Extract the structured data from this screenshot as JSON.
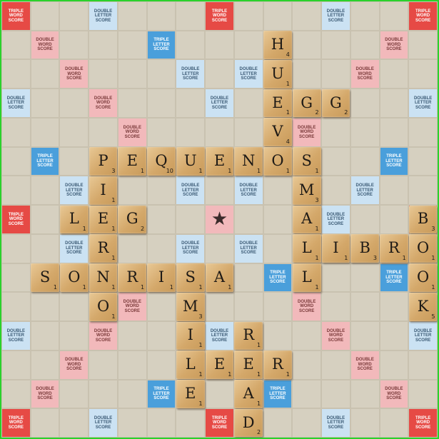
{
  "board": {
    "size": 15,
    "colors": {
      "TW": "#e64a45",
      "DW": "#f2b9bb",
      "TL": "#4a9fdb",
      "DL": "#cbe2f3",
      "plain": "#d6d0c0"
    },
    "labels": {
      "TW": "TRIPLE WORD SCORE",
      "DW": "DOUBLE WORD SCORE",
      "TL": "TRIPLE LETTER SCORE",
      "DL": "DOUBLE LETTER SCORE"
    },
    "premium_rows": [
      "T..d...T...d..T",
      ".D...t...t...D.",
      "..D...d.d...D..",
      "d..D...d...D..d",
      "....D.....D....",
      ".t...t...t...t.",
      "..d...d.d...d..",
      "T..d...S...d..T",
      "..d...d.d...d..",
      ".t...t...t...t.",
      "....D.....D....",
      "d..D...d...D..d",
      "..D...d.d...D..",
      ".D...t...t...D.",
      "T..d...T...d..T"
    ],
    "center_icon": "star-icon"
  },
  "tiles": [
    {
      "letter": "H",
      "points": "4",
      "row": 1,
      "col": 9
    },
    {
      "letter": "U",
      "points": "1",
      "row": 2,
      "col": 9
    },
    {
      "letter": "E",
      "points": "1",
      "row": 3,
      "col": 9
    },
    {
      "letter": "G",
      "points": "2",
      "row": 3,
      "col": 10
    },
    {
      "letter": "G",
      "points": "2",
      "row": 3,
      "col": 11
    },
    {
      "letter": "V",
      "points": "4",
      "row": 4,
      "col": 9
    },
    {
      "letter": "P",
      "points": "3",
      "row": 5,
      "col": 3
    },
    {
      "letter": "E",
      "points": "1",
      "row": 5,
      "col": 4
    },
    {
      "letter": "Q",
      "points": "10",
      "row": 5,
      "col": 5
    },
    {
      "letter": "U",
      "points": "1",
      "row": 5,
      "col": 6
    },
    {
      "letter": "E",
      "points": "1",
      "row": 5,
      "col": 7
    },
    {
      "letter": "N",
      "points": "1",
      "row": 5,
      "col": 8
    },
    {
      "letter": "O",
      "points": "1",
      "row": 5,
      "col": 9
    },
    {
      "letter": "S",
      "points": "1",
      "row": 5,
      "col": 10
    },
    {
      "letter": "I",
      "points": "1",
      "row": 6,
      "col": 3
    },
    {
      "letter": "M",
      "points": "3",
      "row": 6,
      "col": 10
    },
    {
      "letter": "L",
      "points": "1",
      "row": 7,
      "col": 2
    },
    {
      "letter": "E",
      "points": "1",
      "row": 7,
      "col": 3
    },
    {
      "letter": "G",
      "points": "2",
      "row": 7,
      "col": 4
    },
    {
      "letter": "A",
      "points": "1",
      "row": 7,
      "col": 10
    },
    {
      "letter": "B",
      "points": "3",
      "row": 7,
      "col": 14
    },
    {
      "letter": "R",
      "points": "1",
      "row": 8,
      "col": 3
    },
    {
      "letter": "L",
      "points": "1",
      "row": 8,
      "col": 10
    },
    {
      "letter": "I",
      "points": "1",
      "row": 8,
      "col": 11
    },
    {
      "letter": "B",
      "points": "3",
      "row": 8,
      "col": 12
    },
    {
      "letter": "R",
      "points": "1",
      "row": 8,
      "col": 13
    },
    {
      "letter": "O",
      "points": "1",
      "row": 8,
      "col": 14
    },
    {
      "letter": "S",
      "points": "1",
      "row": 9,
      "col": 1
    },
    {
      "letter": "O",
      "points": "1",
      "row": 9,
      "col": 2
    },
    {
      "letter": "N",
      "points": "1",
      "row": 9,
      "col": 3
    },
    {
      "letter": "R",
      "points": "1",
      "row": 9,
      "col": 4
    },
    {
      "letter": "I",
      "points": "1",
      "row": 9,
      "col": 5
    },
    {
      "letter": "S",
      "points": "1",
      "row": 9,
      "col": 6
    },
    {
      "letter": "A",
      "points": "1",
      "row": 9,
      "col": 7
    },
    {
      "letter": "L",
      "points": "1",
      "row": 9,
      "col": 10
    },
    {
      "letter": "O",
      "points": "1",
      "row": 9,
      "col": 14
    },
    {
      "letter": "O",
      "points": "1",
      "row": 10,
      "col": 3
    },
    {
      "letter": "M",
      "points": "3",
      "row": 10,
      "col": 6
    },
    {
      "letter": "K",
      "points": "5",
      "row": 10,
      "col": 14
    },
    {
      "letter": "I",
      "points": "1",
      "row": 11,
      "col": 6
    },
    {
      "letter": "R",
      "points": "1",
      "row": 11,
      "col": 8
    },
    {
      "letter": "L",
      "points": "1",
      "row": 12,
      "col": 6
    },
    {
      "letter": "E",
      "points": "1",
      "row": 12,
      "col": 7
    },
    {
      "letter": "E",
      "points": "1",
      "row": 12,
      "col": 8
    },
    {
      "letter": "R",
      "points": "1",
      "row": 12,
      "col": 9
    },
    {
      "letter": "E",
      "points": "1",
      "row": 13,
      "col": 6
    },
    {
      "letter": "A",
      "points": "1",
      "row": 13,
      "col": 8
    },
    {
      "letter": "D",
      "points": "2",
      "row": 14,
      "col": 8
    }
  ]
}
